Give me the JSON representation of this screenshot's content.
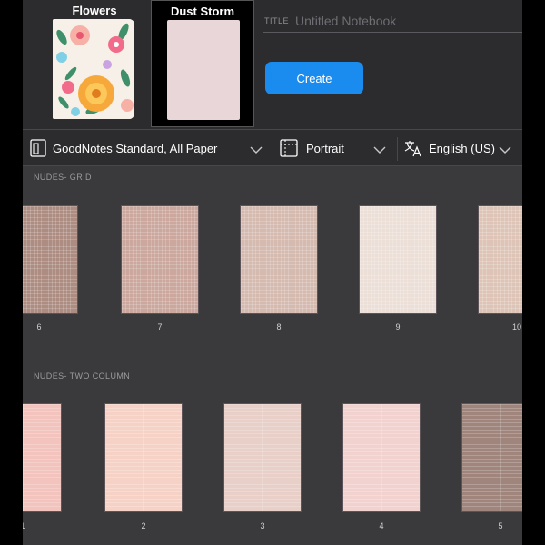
{
  "covers": [
    {
      "title": "Flowers",
      "colors": {
        "bg": "#f6f0e8",
        "accent": "#f7a83a",
        "pink": "#f36b8a"
      }
    },
    {
      "title": "Dust Storm",
      "colors": {
        "bg": "#e8d6d8"
      }
    }
  ],
  "title_field": {
    "label": "TITLE",
    "placeholder": "Untitled Notebook",
    "value": ""
  },
  "create_button": {
    "label": "Create",
    "color": "#1a8cf0"
  },
  "options": {
    "template": {
      "label": "GoodNotes Standard, All Paper",
      "icon": "page-template-icon"
    },
    "orientation": {
      "label": "Portrait",
      "icon": "page-size-icon"
    },
    "language": {
      "label": "English (US)",
      "icon": "translate-icon"
    }
  },
  "sections": [
    {
      "title": "NUDES- GRID",
      "pattern": "grid",
      "items": [
        {
          "number": "6",
          "color": "#ad8c82"
        },
        {
          "number": "7",
          "color": "#cba79d"
        },
        {
          "number": "8",
          "color": "#d5bab0"
        },
        {
          "number": "9",
          "color": "#ebdfd7"
        },
        {
          "number": "10",
          "color": "#ddc4b6"
        }
      ]
    },
    {
      "title": "NUDES- TWO COLUMN",
      "pattern": "two-column",
      "items": [
        {
          "number": "1",
          "color": "#f3c3bd"
        },
        {
          "number": "2",
          "color": "#f6d2c6"
        },
        {
          "number": "3",
          "color": "#e8cfc8"
        },
        {
          "number": "4",
          "color": "#f2d2cf"
        },
        {
          "number": "5",
          "color": "#a0857d"
        }
      ]
    }
  ]
}
